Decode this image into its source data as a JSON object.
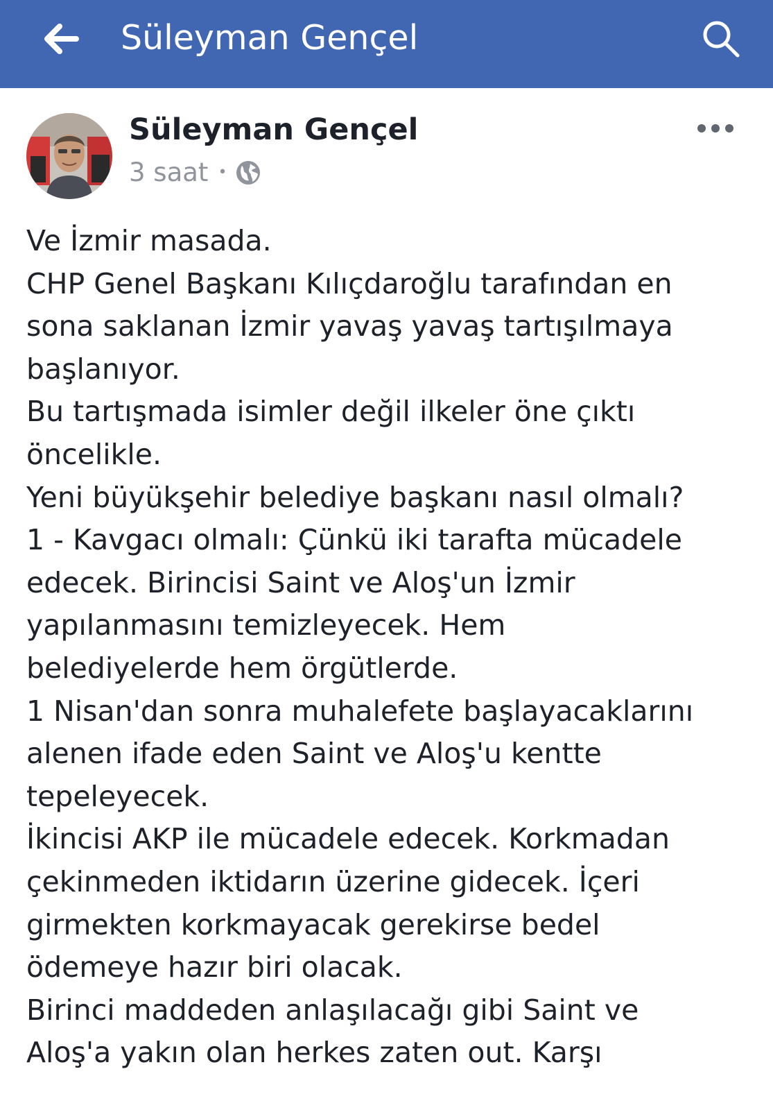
{
  "header": {
    "title": "Süleyman Gençel",
    "back_icon": "back-arrow-icon",
    "search_icon": "search-icon",
    "bar_color": "#4267b2"
  },
  "post": {
    "author": "Süleyman Gençel",
    "time": "3 saat",
    "separator": "•",
    "privacy_icon": "globe-icon",
    "more_icon": "more-options-icon",
    "lines": [
      "Ve İzmir masada.",
      "CHP Genel Başkanı Kılıçdaroğlu tarafından en",
      "sona saklanan İzmir yavaş yavaş tartışılmaya",
      "başlanıyor.",
      "Bu tartışmada isimler değil ilkeler öne çıktı",
      "öncelikle.",
      "Yeni büyükşehir belediye başkanı nasıl olmalı?",
      "1 - Kavgacı olmalı: Çünkü iki tarafta mücadele",
      "edecek. Birincisi Saint ve Aloş'un İzmir",
      "yapılanmasını temizleyecek. Hem",
      "belediyelerde hem örgütlerde.",
      "1 Nisan'dan sonra muhalefete başlayacaklarını",
      "alenen ifade eden Saint ve Aloş'u kentte",
      "tepeleyecek.",
      "İkincisi AKP ile mücadele edecek. Korkmadan",
      "çekinmeden iktidarın üzerine gidecek. İçeri",
      "girmekten korkmayacak gerekirse bedel",
      "ödemeye hazır biri olacak.",
      "Birinci maddeden anlaşılacağı gibi Saint ve",
      "Aloş'a yakın olan herkes zaten out. Karşı"
    ]
  }
}
